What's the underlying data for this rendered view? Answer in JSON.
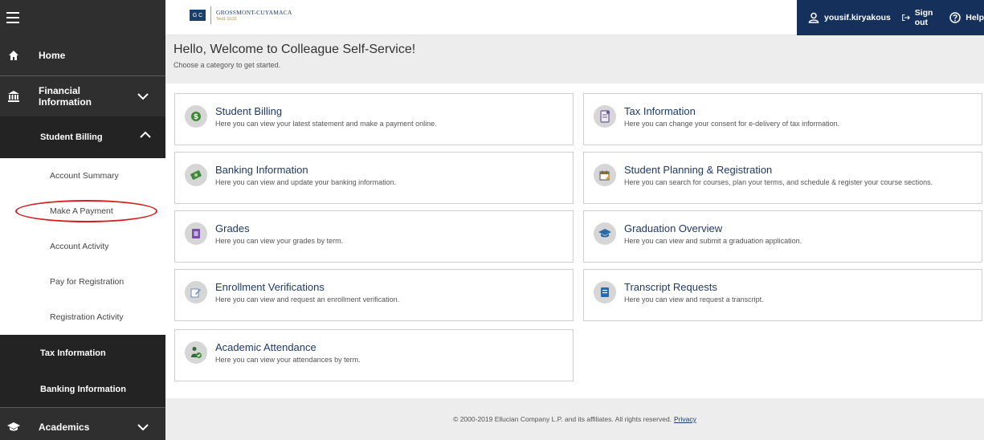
{
  "sidebar": {
    "home": "Home",
    "financial": "Financial Information",
    "student_billing": "Student Billing",
    "sub_items": [
      "Account Summary",
      "Make A Payment",
      "Account Activity",
      "Pay for Registration",
      "Registration Activity"
    ],
    "tax_information": "Tax Information",
    "banking_information": "Banking Information",
    "academics": "Academics"
  },
  "header": {
    "logo_badge": "G C",
    "logo_name": "GROSSMONT-CUYAMACA",
    "logo_sub": "Test1 G133",
    "username": "yousif.kiryakous",
    "sign_out": "Sign out",
    "help": "Help"
  },
  "welcome": {
    "title": "Hello, Welcome to Colleague Self-Service!",
    "subtitle": "Choose a category to get started."
  },
  "cards": [
    {
      "title": "Student Billing",
      "desc": "Here you can view your latest statement and make a payment online."
    },
    {
      "title": "Tax Information",
      "desc": "Here you can change your consent for e-delivery of tax information."
    },
    {
      "title": "Banking Information",
      "desc": "Here you can view and update your banking information."
    },
    {
      "title": "Student Planning & Registration",
      "desc": "Here you can search for courses, plan your terms, and schedule & register your course sections."
    },
    {
      "title": "Grades",
      "desc": "Here you can view your grades by term."
    },
    {
      "title": "Graduation Overview",
      "desc": "Here you can view and submit a graduation application."
    },
    {
      "title": "Enrollment Verifications",
      "desc": "Here you can view and request an enrollment verification."
    },
    {
      "title": "Transcript Requests",
      "desc": "Here you can view and request a transcript."
    },
    {
      "title": "Academic Attendance",
      "desc": "Here you can view your attendances by term."
    }
  ],
  "footer": {
    "copyright": "© 2000-2019 Ellucian Company L.P. and its affiliates. All rights reserved.",
    "privacy": "Privacy"
  },
  "colors": {
    "sidebar": "#2f2f2f",
    "sidebar_active": "#232323",
    "userbar": "#16305c",
    "card_title": "#1f3a66",
    "highlight": "#d21f1f"
  }
}
